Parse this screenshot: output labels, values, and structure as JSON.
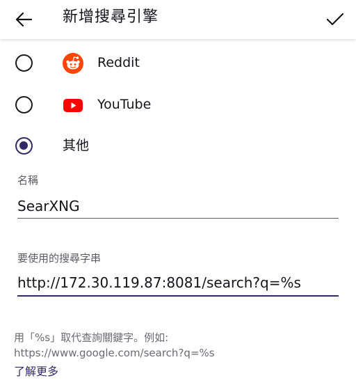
{
  "app_bar": {
    "title": "新增搜尋引擎"
  },
  "options": [
    {
      "label": "Reddit",
      "icon": "reddit-icon",
      "selected": false
    },
    {
      "label": "YouTube",
      "icon": "youtube-icon",
      "selected": false
    },
    {
      "label": "其他",
      "icon": "",
      "selected": true
    }
  ],
  "name_field": {
    "label": "名稱",
    "value": "SearXNG"
  },
  "search_string_field": {
    "label": "要使用的搜尋字串",
    "value": "http://172.30.119.87:8081/search?q=%s"
  },
  "help": {
    "line1": "用「%s」取代查詢關鍵字。例如:",
    "line2": "https://www.google.com/search?q=%s",
    "learn_more": "了解更多"
  },
  "colors": {
    "accent": "#312a65",
    "reddit": "#ff4500",
    "youtube": "#ff0000"
  }
}
